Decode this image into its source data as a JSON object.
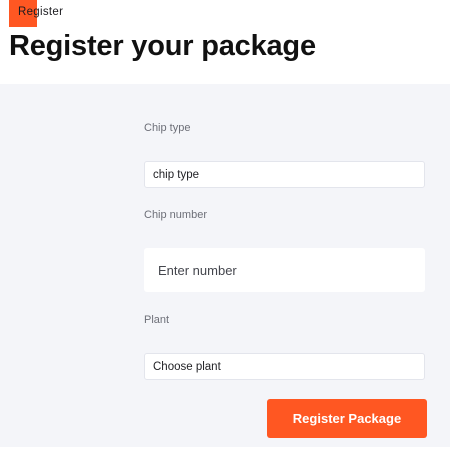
{
  "header": {
    "breadcrumb": "Register",
    "title": "Register your package",
    "accent_color": "#ff5722"
  },
  "form": {
    "chip_type": {
      "label": "Chip type",
      "value": "chip type"
    },
    "chip_number": {
      "label": "Chip number",
      "placeholder": "Enter number"
    },
    "plant": {
      "label": "Plant",
      "value": "Choose plant"
    },
    "submit_label": "Register Package"
  }
}
